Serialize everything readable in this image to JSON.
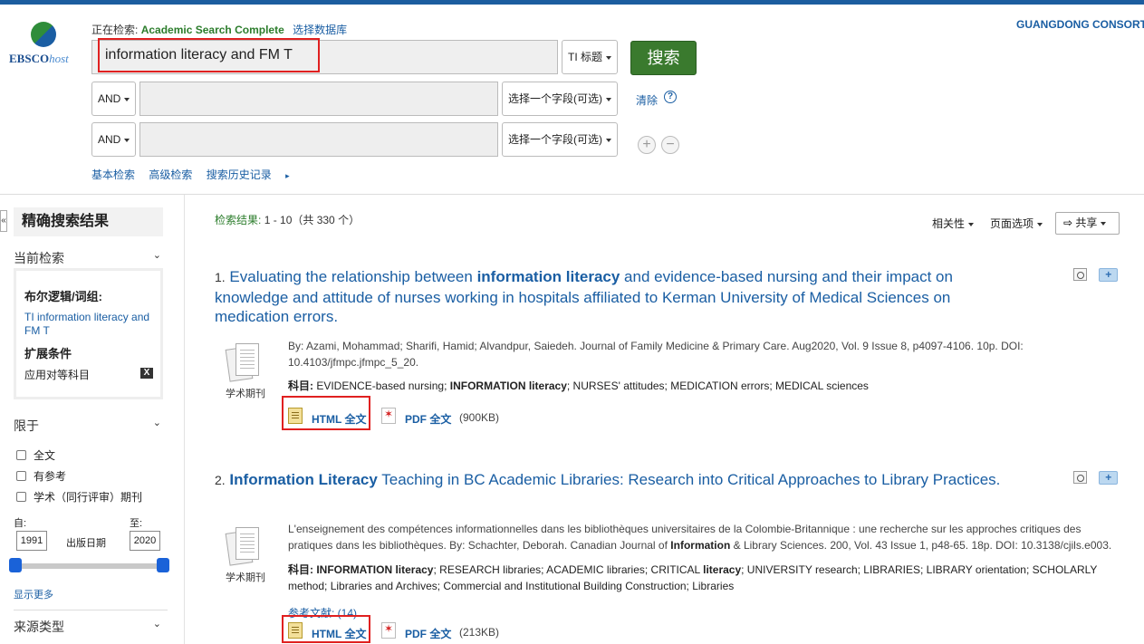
{
  "header": {
    "logo_text": "EBSCO",
    "logo_suffix": "host",
    "searching_label": "正在检索:",
    "database": "Academic Search Complete",
    "choose_db": "选择数据库",
    "consortium": "GUANGDONG CONSORT",
    "query": "information literacy and FM T",
    "field_main": "TI 标题",
    "search_button": "搜索",
    "row2_bool": "AND",
    "row2_field": "选择一个字段(可选)",
    "row3_bool": "AND",
    "row3_field": "选择一个字段(可选)",
    "clear": "清除",
    "help": "?",
    "add": "+",
    "remove": "−",
    "links": {
      "basic": "基本检索",
      "advanced": "高级检索",
      "history": "搜索历史记录"
    }
  },
  "sidebar": {
    "collapse": "«",
    "title": "精确搜索结果",
    "current_search": "当前检索",
    "boolean_label": "布尔逻辑/词组:",
    "boolean_value": "TI information literacy and FM T",
    "expanders_label": "扩展条件",
    "expander_item": "应用对等科目",
    "expander_remove": "X",
    "limit_to": "限于",
    "checkboxes": [
      "全文",
      "有参考",
      "学术（同行评审）期刊"
    ],
    "from_label": "自:",
    "to_label": "至:",
    "from_year": "1991",
    "to_year": "2020",
    "pub_date": "出版日期",
    "show_more": "显示更多",
    "source_types": "来源类型"
  },
  "results": {
    "count_label": "检索结果:",
    "count_value": "1 - 10（共 330 个）",
    "sort": "相关性",
    "page_options": "页面选项",
    "share": "共享",
    "items": [
      {
        "num": "1.",
        "title_parts": [
          "Evaluating the relationship between ",
          "information literacy",
          " and evidence-based nursing and their impact on knowledge and attitude of nurses working in hospitals affiliated to Kerman University of Medical Sciences on medication errors."
        ],
        "meta": "By: Azami, Mohammad; Sharifi, Hamid; Alvandpur, Saiedeh. Journal of Family Medicine & Primary Care. Aug2020, Vol. 9 Issue 8, p4097-4106. 10p. DOI: 10.4103/jfmpc.jfmpc_5_20.",
        "subject_label": "科目:",
        "subject_parts": [
          "EVIDENCE-based nursing; ",
          "INFORMATION literacy",
          "; NURSES' attitudes; MEDICATION errors; MEDICAL sciences"
        ],
        "type": "学术期刊",
        "html_full": "HTML 全文",
        "pdf_full": "PDF 全文",
        "pdf_size": "(900KB)"
      },
      {
        "num": "2.",
        "title_parts": [
          "Information Literacy",
          " Teaching in BC Academic Libraries: Research into Critical Approaches to Library Practices."
        ],
        "meta_parts": [
          "L'enseignement des compétences informationnelles dans les bibliothèques universitaires de la Colombie-Britannique : une recherche sur les approches critiques des pratiques dans les bibliothèques. By: Schachter, Deborah. Canadian Journal of ",
          "Information",
          " & Library Sciences. 200, Vol. 43 Issue 1, p48-65. 18p. DOI: 10.3138/cjils.e003."
        ],
        "subject_label": "科目:",
        "subject_parts": [
          "INFORMATION literacy",
          "; RESEARCH libraries; ACADEMIC libraries; CRITICAL ",
          "literacy",
          "; UNIVERSITY research; LIBRARIES; LIBRARY orientation; SCHOLARLY method; Libraries and Archives; Commercial and Institutional Building Construction; Libraries"
        ],
        "type": "学术期刊",
        "refs": "参考文献: (14)",
        "html_full": "HTML 全文",
        "pdf_full": "PDF 全文",
        "pdf_size": "(213KB)"
      }
    ]
  },
  "colors": {
    "accent": "#1a5ea3",
    "highlight_box": "#e02020",
    "search_button": "#3a7a2e",
    "database": "#2c7d2c"
  }
}
